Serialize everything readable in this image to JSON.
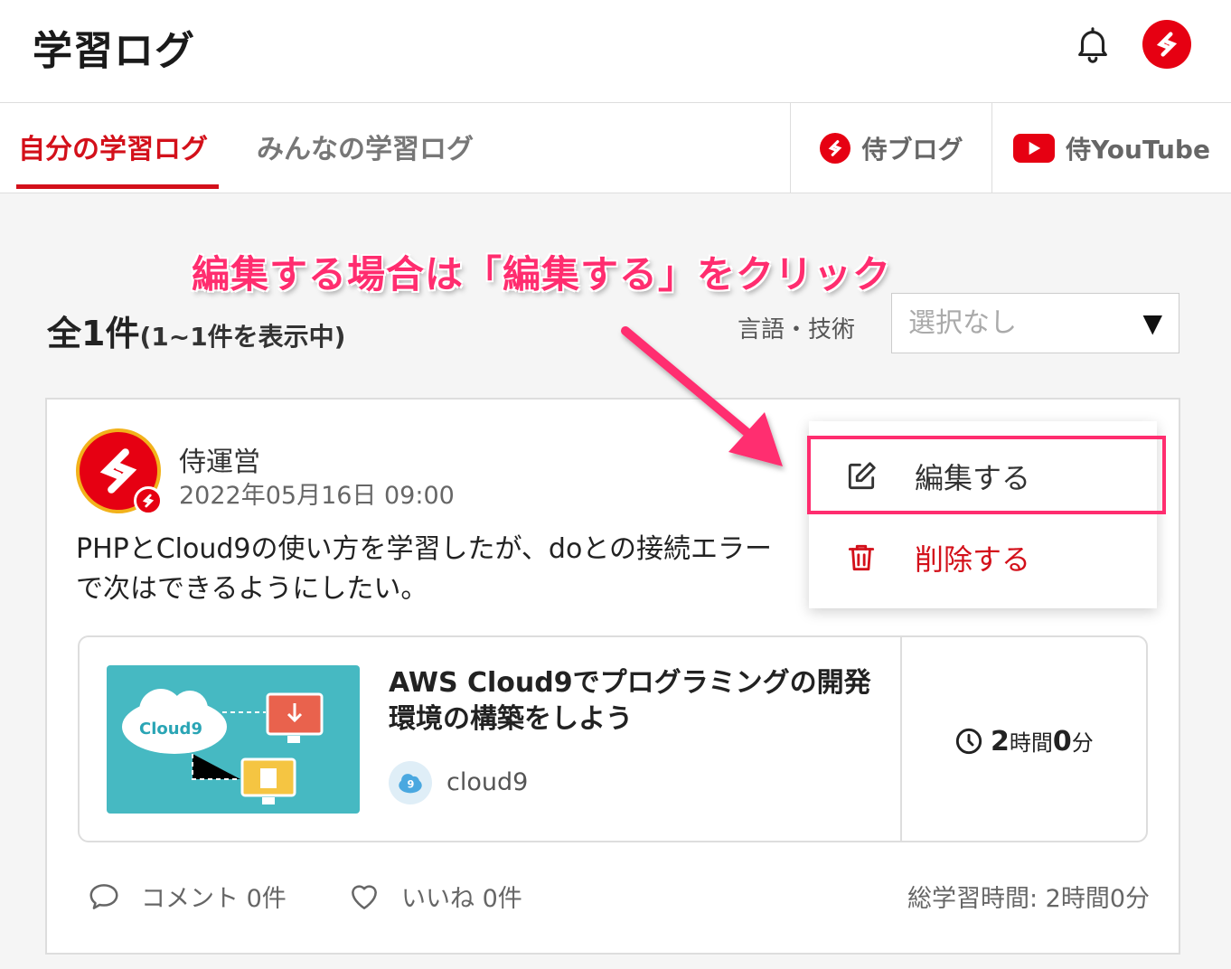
{
  "header": {
    "title": "学習ログ",
    "notification_icon": "bell-icon",
    "logo_icon": "samurai-logo"
  },
  "tabs": {
    "mine": "自分の学習ログ",
    "all": "みんなの学習ログ",
    "blog": "侍ブログ",
    "youtube": "侍YouTube"
  },
  "annotation": "編集する場合は「編集する」をクリック",
  "summary": {
    "total": "全1件",
    "range": "(1~1件を表示中)"
  },
  "filter": {
    "label": "言語・技術",
    "value": "選択なし",
    "arrow": "▼"
  },
  "post": {
    "author": "侍運営",
    "date": "2022年05月16日 09:00",
    "body": "PHPとCloud9の使い方を学習したが、doとの接続エラー\nで次はできるようにしたい。",
    "course": {
      "title": "AWS Cloud9でプログラミングの開発環境の構築をしよう",
      "tag": "cloud9",
      "thumb_label": "Cloud9",
      "time_hours": "2",
      "time_h_unit": "時間",
      "time_mins": "0",
      "time_m_unit": "分"
    },
    "comments": "コメント 0件",
    "likes": "いいね 0件",
    "total_time": "総学習時間: 2時間0分"
  },
  "menu": {
    "edit": "編集する",
    "delete": "削除する"
  },
  "colors": {
    "accent": "#d3101a",
    "highlight": "#ff2d6f"
  }
}
